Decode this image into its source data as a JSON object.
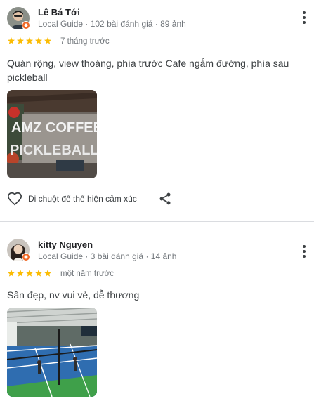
{
  "reviews": [
    {
      "reviewer_name": "Lê Bá Tới",
      "reviewer_meta": "Local Guide · 102 bài đánh giá · 89 ảnh",
      "rating": 5,
      "date": "7 tháng trước",
      "text": "Quán rộng, view thoáng, phía trước Cafe ngắm đường, phía sau pickleball",
      "photo": {
        "sign_line_1": "AMZ COFFEE",
        "sign_line_2": "PICKLEBALL"
      }
    },
    {
      "reviewer_name": "kitty Nguyen",
      "reviewer_meta": "Local Guide · 3 bài đánh giá · 14 ảnh",
      "rating": 5,
      "date": "một năm trước",
      "text": "Sân đẹp, nv vui vẻ, dễ thương"
    }
  ],
  "actions": {
    "react_label": "Di chuột để thể hiện cảm xúc"
  },
  "icons": {
    "more": "more-vert-icon",
    "like": "heart-outline-icon",
    "share": "share-icon",
    "star": "star-icon",
    "local_guide": "local-guide-badge-icon"
  },
  "colors": {
    "star": "#fbbc04",
    "badge": "#f06a28",
    "court": "#2f6db0"
  }
}
